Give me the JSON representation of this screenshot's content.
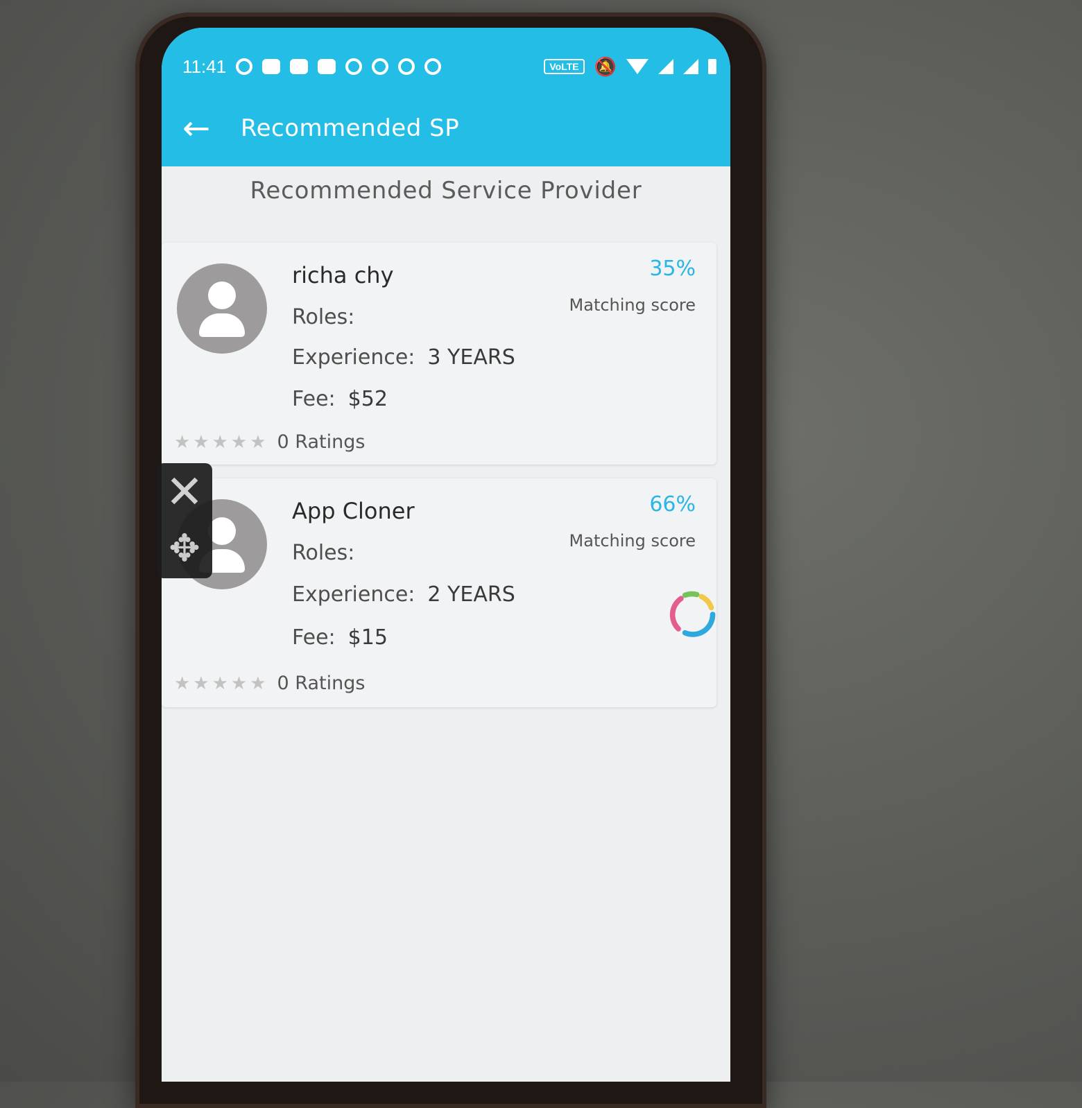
{
  "status_bar": {
    "time": "11:41",
    "network_badge": "VoLTE"
  },
  "toolbar": {
    "back_icon": "arrow-left-icon",
    "title": "Recommended SP"
  },
  "section": {
    "heading": "Recommended Service Provider"
  },
  "providers": [
    {
      "name": "richa chy",
      "roles_label": "Roles:",
      "roles_value": "",
      "experience_label": "Experience:",
      "experience_value": "3 YEARS",
      "fee_label": "Fee:",
      "fee_value": "$52",
      "match_percent": "35%",
      "match_label": "Matching score",
      "stars": "★★★★★",
      "ratings_text": "0 Ratings"
    },
    {
      "name": "App Cloner",
      "roles_label": "Roles:",
      "roles_value": "",
      "experience_label": "Experience:",
      "experience_value": "2 YEARS",
      "fee_label": "Fee:",
      "fee_value": "$15",
      "match_percent": "66%",
      "match_label": "Matching score",
      "stars": "★★★★★",
      "ratings_text": "0 Ratings"
    }
  ],
  "colors": {
    "app_bar": "#23bde6",
    "accent": "#29b6e6",
    "spinner_segments": [
      "#e35d8f",
      "#78c25a",
      "#f2c84b",
      "#2fa8e0"
    ]
  },
  "overlay": {
    "close_icon": "close-icon",
    "move_icon": "move-icon"
  }
}
